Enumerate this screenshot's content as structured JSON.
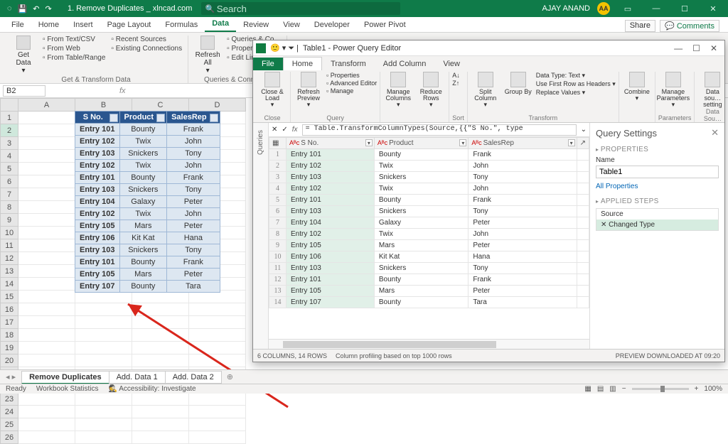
{
  "title_bar": {
    "doc_title": "1. Remove Duplicates _ xlncad.com",
    "search_placeholder": "Search",
    "user": "AJAY ANAND",
    "avatar_initials": "AA"
  },
  "menu": {
    "tabs": [
      "File",
      "Home",
      "Insert",
      "Page Layout",
      "Formulas",
      "Data",
      "Review",
      "View",
      "Developer",
      "Power Pivot"
    ],
    "active_index": 5,
    "share_label": "Share",
    "comments_label": "Comments"
  },
  "ribbon": {
    "group1": {
      "btn": "Get Data",
      "links": [
        "From Text/CSV",
        "From Web",
        "From Table/Range",
        "Recent Sources",
        "Existing Connections"
      ],
      "label": "Get & Transform Data"
    },
    "group2": {
      "btn": "Refresh All",
      "links": [
        "Queries & Co…",
        "Properties",
        "Edit Links"
      ],
      "label": "Queries & Connect…"
    }
  },
  "name_box": "B2",
  "sheet": {
    "cols": [
      "A",
      "B",
      "C",
      "D"
    ],
    "headers": [
      "S No.",
      "Product",
      "SalesRep"
    ],
    "rows": [
      [
        "Entry 101",
        "Bounty",
        "Frank"
      ],
      [
        "Entry 102",
        "Twix",
        "John"
      ],
      [
        "Entry 103",
        "Snickers",
        "Tony"
      ],
      [
        "Entry 102",
        "Twix",
        "John"
      ],
      [
        "Entry 101",
        "Bounty",
        "Frank"
      ],
      [
        "Entry 103",
        "Snickers",
        "Tony"
      ],
      [
        "Entry 104",
        "Galaxy",
        "Peter"
      ],
      [
        "Entry 102",
        "Twix",
        "John"
      ],
      [
        "Entry 105",
        "Mars",
        "Peter"
      ],
      [
        "Entry 106",
        "Kit Kat",
        "Hana"
      ],
      [
        "Entry 103",
        "Snickers",
        "Tony"
      ],
      [
        "Entry 101",
        "Bounty",
        "Frank"
      ],
      [
        "Entry 105",
        "Mars",
        "Peter"
      ],
      [
        "Entry 107",
        "Bounty",
        "Tara"
      ]
    ]
  },
  "sheet_tabs": {
    "tabs": [
      "Remove Duplicates",
      "Add. Data 1",
      "Add. Data 2"
    ],
    "active_index": 0
  },
  "status_bar": {
    "ready": "Ready",
    "stats": "Workbook Statistics",
    "acc": "Accessibility: Investigate",
    "zoom": "100%"
  },
  "pq": {
    "title": "Table1 - Power Query Editor",
    "tabs": [
      "File",
      "Home",
      "Transform",
      "Add Column",
      "View"
    ],
    "active_tab": 1,
    "ribbon": {
      "close": "Close & Load",
      "close_lbl": "Close",
      "refresh": "Refresh Preview",
      "q_links": [
        "Properties",
        "Advanced Editor",
        "Manage"
      ],
      "query_lbl": "Query",
      "manage_cols": "Manage Columns",
      "reduce_rows": "Reduce Rows",
      "sort_lbl": "Sort",
      "split": "Split Column",
      "group": "Group By",
      "t_links": [
        "Data Type: Text",
        "Use First Row as Headers",
        "Replace Values"
      ],
      "transform_lbl": "Transform",
      "combine": "Combine",
      "params": "Manage Parameters",
      "params_lbl": "Parameters",
      "ds": "Data sou… setting",
      "ds_lbl": "Data Sou…"
    },
    "queries_gutter": "Queries",
    "formula_fx": "fx",
    "formula": "= Table.TransformColumnTypes(Source,{{\"S No.\", type",
    "grid_headers": [
      "S No.",
      "Product",
      "SalesRep"
    ],
    "grid_rows": [
      [
        "Entry 101",
        "Bounty",
        "Frank"
      ],
      [
        "Entry 102",
        "Twix",
        "John"
      ],
      [
        "Entry 103",
        "Snickers",
        "Tony"
      ],
      [
        "Entry 102",
        "Twix",
        "John"
      ],
      [
        "Entry 101",
        "Bounty",
        "Frank"
      ],
      [
        "Entry 103",
        "Snickers",
        "Tony"
      ],
      [
        "Entry 104",
        "Galaxy",
        "Peter"
      ],
      [
        "Entry 102",
        "Twix",
        "John"
      ],
      [
        "Entry 105",
        "Mars",
        "Peter"
      ],
      [
        "Entry 106",
        "Kit Kat",
        "Hana"
      ],
      [
        "Entry 103",
        "Snickers",
        "Tony"
      ],
      [
        "Entry 101",
        "Bounty",
        "Frank"
      ],
      [
        "Entry 105",
        "Mars",
        "Peter"
      ],
      [
        "Entry 107",
        "Bounty",
        "Tara"
      ]
    ],
    "status_left": "6 COLUMNS, 14 ROWS",
    "status_mid": "Column profiling based on top 1000 rows",
    "status_right": "PREVIEW DOWNLOADED AT 09:20",
    "settings": {
      "title": "Query Settings",
      "properties_hd": "PROPERTIES",
      "name_lbl": "Name",
      "name_val": "Table1",
      "all_props": "All Properties",
      "steps_hd": "APPLIED STEPS",
      "steps": [
        "Source",
        "Changed Type"
      ],
      "selected_step": 1
    }
  }
}
